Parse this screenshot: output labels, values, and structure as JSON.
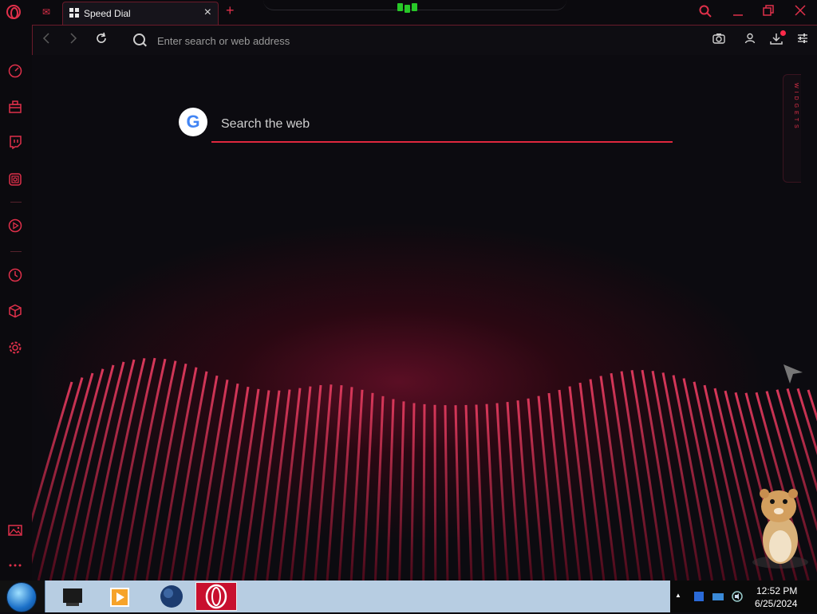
{
  "tab": {
    "title": "Speed Dial",
    "close_symbol": "×",
    "new_tab_symbol": "+"
  },
  "address_bar": {
    "placeholder": "Enter search or web address"
  },
  "speed_dial": {
    "search_placeholder": "Search the web",
    "engine_letter": "G",
    "widgets_label": "WIDGETS"
  },
  "sidebar": {
    "icons": [
      "speedometer-icon",
      "gx-control-icon",
      "twitch-icon",
      "instagram-icon",
      "player-icon",
      "history-icon",
      "extensions-icon",
      "settings-icon",
      "wallpaper-icon",
      "more-icon"
    ]
  },
  "taskbar": {
    "time": "12:52 PM",
    "date": "6/25/2024"
  },
  "colors": {
    "accent": "#e0304a",
    "background": "#0c0b10",
    "taskbar_strip": "#b7cde2"
  }
}
